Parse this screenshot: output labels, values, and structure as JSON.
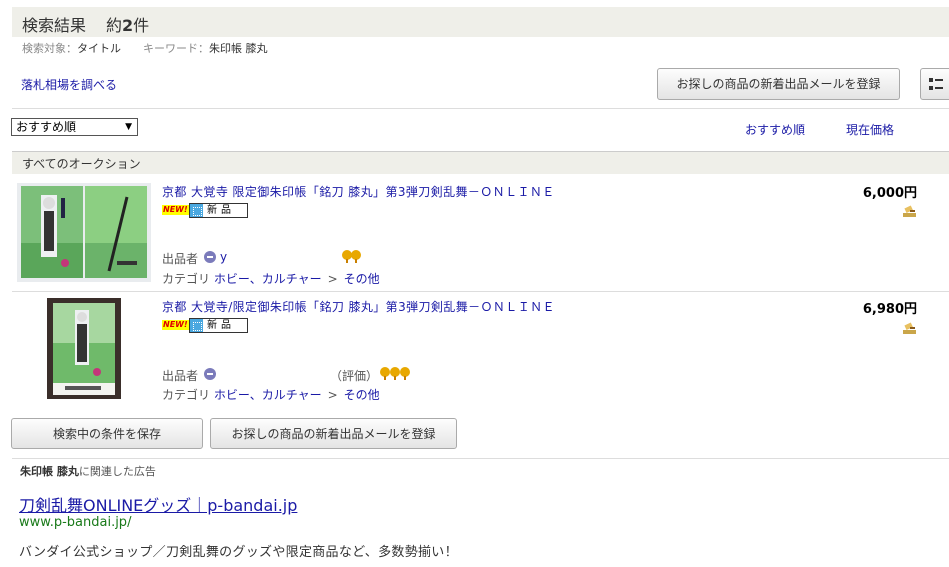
{
  "header": {
    "title": "検索結果",
    "count_prefix": "約",
    "count_value": "2",
    "count_suffix": "件"
  },
  "criteria": {
    "target_label": "検索対象：",
    "target_value": "タイトル",
    "keyword_label": "キーワード：",
    "keyword_value": "朱印帳 膝丸"
  },
  "market_link": "落札相場を調べる",
  "buttons": {
    "mail_register": "お探しの商品の新着出品メールを登録",
    "save_condition": "検索中の条件を保存",
    "view_icon": "list-view-icon"
  },
  "sort": {
    "selected": "おすすめ順",
    "tabs": [
      "おすすめ順",
      "現在価格"
    ]
  },
  "section_title": "すべてのオークション",
  "items": [
    {
      "title": "京都 大覚寺 限定御朱印帳「銘刀 膝丸」第3弾刀剣乱舞－ＯＮＬＩＮＥ",
      "new_badge": "NEW!",
      "condition": "新品",
      "seller_label": "出品者",
      "seller_name": "y",
      "rating_text": "",
      "rating_icons": 2,
      "category_label": "カテゴリ",
      "category_path": [
        "ホビー、カルチャー",
        "その他"
      ],
      "category_sep": ">",
      "price": "6,000円",
      "bid_icon": "gavel-icon"
    },
    {
      "title": "京都 大覚寺/限定御朱印帳「銘刀 膝丸」第3弾刀剣乱舞－ＯＮＬＩＮＥ",
      "new_badge": "NEW!",
      "condition": "新品",
      "seller_label": "出品者",
      "seller_name": "",
      "rating_text": "（評価）",
      "rating_icons": 3,
      "category_label": "カテゴリ",
      "category_path": [
        "ホビー、カルチャー",
        "その他"
      ],
      "category_sep": ">",
      "price": "6,980円",
      "bid_icon": "gavel-icon"
    }
  ],
  "ad": {
    "keyword": "朱印帳 膝丸",
    "label_suffix": "に関連した広告",
    "title": "刀剣乱舞ONLINEグッズ｜p-bandai.jp",
    "url": "www.p-bandai.jp/",
    "description": "バンダイ公式ショップ／刀剣乱舞のグッズや限定商品など、多数勢揃い！"
  },
  "colors": {
    "link": "#1a1aa6",
    "header_bg": "#efefe9",
    "ad_url": "#1a7a1a",
    "new_badge": "#ffff00"
  }
}
